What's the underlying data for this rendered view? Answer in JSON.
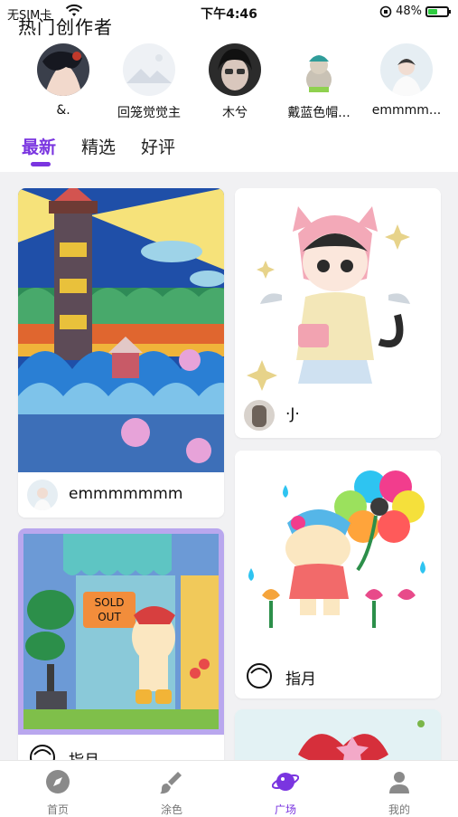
{
  "status_bar": {
    "carrier": "无SIM卡",
    "time": "下午4:46",
    "battery": "48%",
    "battery_level": 0.48
  },
  "section_title": "热门创作者",
  "creators": [
    {
      "name": "&."
    },
    {
      "name": "回笼觉觉主"
    },
    {
      "name": "木兮"
    },
    {
      "name": "戴蓝色帽..."
    },
    {
      "name": "emmmm..."
    }
  ],
  "tabs": [
    {
      "label": "最新",
      "active": true
    },
    {
      "label": "精选",
      "active": false
    },
    {
      "label": "好评",
      "active": false
    }
  ],
  "cards": [
    {
      "author": "emmmmmmm"
    },
    {
      "author": "·J·"
    },
    {
      "author": "指月"
    },
    {
      "author": "指月"
    }
  ],
  "nav": [
    {
      "label": "首页",
      "icon": "compass-icon"
    },
    {
      "label": "涂色",
      "icon": "paint-brush-icon"
    },
    {
      "label": "广场",
      "icon": "planet-icon"
    },
    {
      "label": "我的",
      "icon": "user-icon"
    }
  ],
  "colors": {
    "accent": "#7a35e0",
    "battery": "#2ecc40",
    "feed_background": "#f1f1f3"
  }
}
